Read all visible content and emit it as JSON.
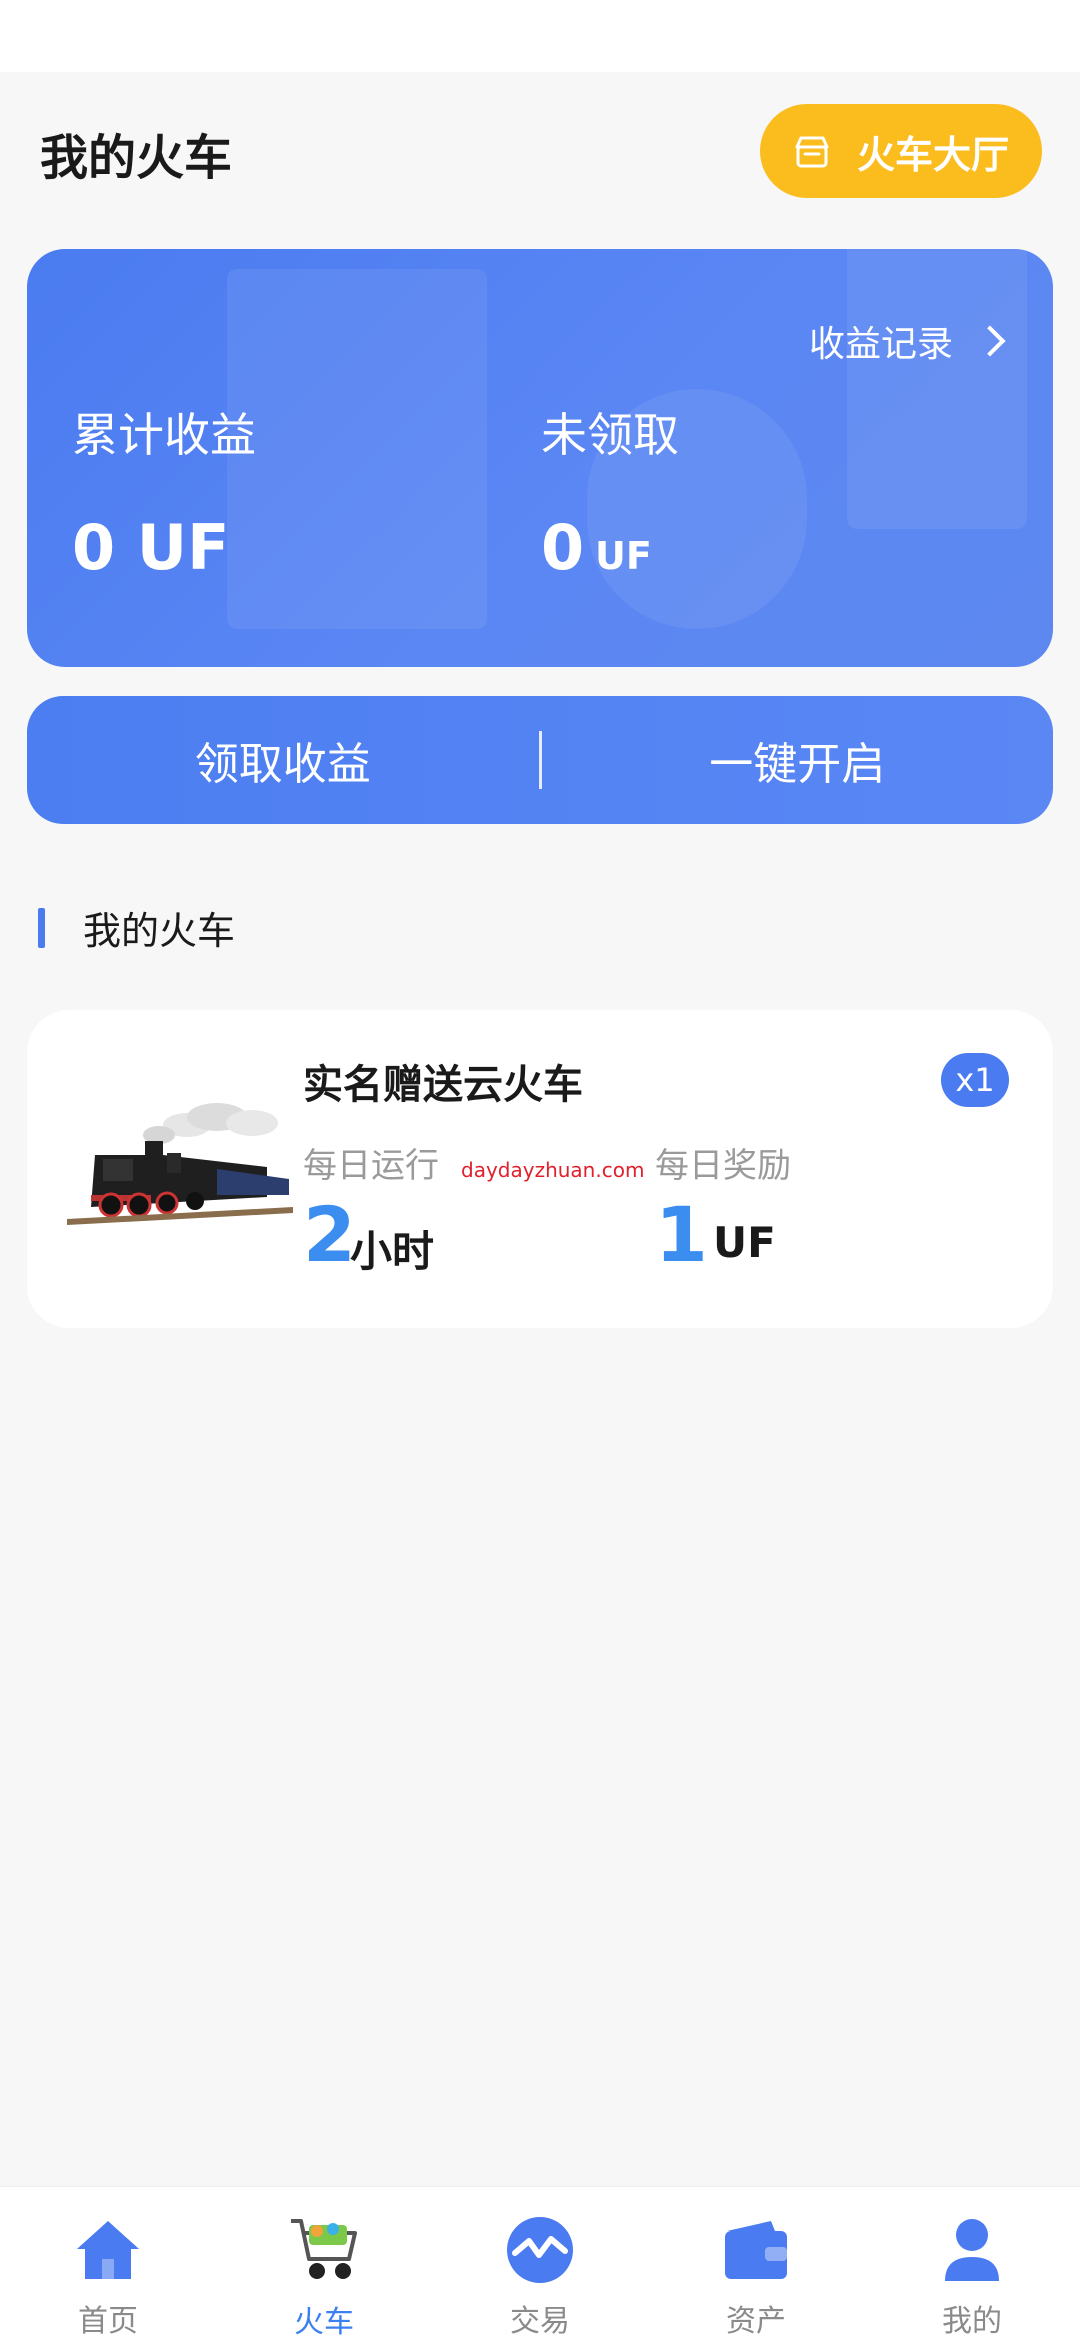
{
  "header": {
    "title": "我的火车",
    "hall_button_label": "火车大厅"
  },
  "earnings": {
    "record_label": "收益记录",
    "total_label": "累计收益",
    "total_value": "0 UF",
    "unclaimed_label": "未领取",
    "unclaimed_value": "0",
    "unclaimed_unit": "UF"
  },
  "actions": {
    "claim_label": "领取收益",
    "start_label": "一键开启"
  },
  "section": {
    "title": "我的火车"
  },
  "train": {
    "name": "实名赠送云火车",
    "count_badge": "x1",
    "daily_run_label": "每日运行",
    "daily_run_value": "2",
    "daily_run_unit": "小时",
    "daily_reward_label": "每日奖励",
    "daily_reward_value": "1",
    "daily_reward_unit": "UF",
    "watermark": "daydayzhuan.com"
  },
  "tabbar": {
    "items": [
      {
        "label": "首页",
        "icon": "home-icon"
      },
      {
        "label": "火车",
        "icon": "cart-icon"
      },
      {
        "label": "交易",
        "icon": "trade-icon"
      },
      {
        "label": "资产",
        "icon": "wallet-icon"
      },
      {
        "label": "我的",
        "icon": "user-icon"
      }
    ],
    "active_index": 1
  },
  "colors": {
    "primary": "#4a7bf0",
    "accent_yellow": "#fbbc1d",
    "number_blue": "#3b8ef0"
  }
}
